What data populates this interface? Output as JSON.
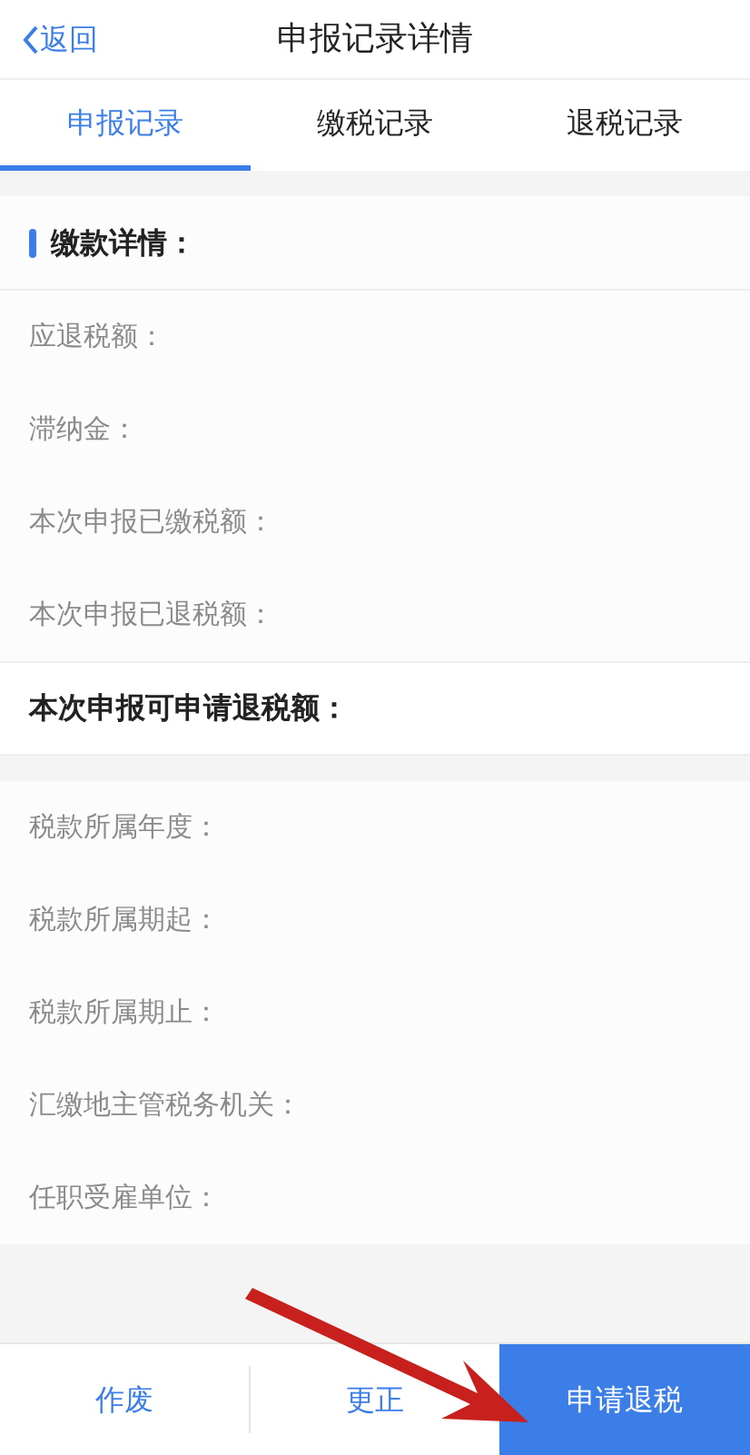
{
  "header": {
    "back": "返回",
    "title": "申报记录详情"
  },
  "tabs": [
    {
      "label": "申报记录",
      "selected": true
    },
    {
      "label": "缴税记录",
      "selected": false
    },
    {
      "label": "退税记录",
      "selected": false
    }
  ],
  "sections": [
    {
      "rows": [
        {
          "kind": "heading",
          "label": "缴款详情："
        },
        {
          "kind": "field",
          "label": "应退税额："
        },
        {
          "kind": "field",
          "label": "滞纳金："
        },
        {
          "kind": "field",
          "label": "本次申报已缴税额："
        },
        {
          "kind": "field",
          "label": "本次申报已退税额："
        },
        {
          "kind": "total",
          "label": "本次申报可申请退税额："
        }
      ]
    },
    {
      "rows": [
        {
          "kind": "field",
          "label": "税款所属年度："
        },
        {
          "kind": "field",
          "label": "税款所属期起："
        },
        {
          "kind": "field",
          "label": "税款所属期止："
        },
        {
          "kind": "field",
          "label": "汇缴地主管税务机关："
        },
        {
          "kind": "field",
          "label": "任职受雇单位："
        }
      ]
    }
  ],
  "footer": {
    "buttons": [
      {
        "label": "作废",
        "kind": "link"
      },
      {
        "label": "更正",
        "kind": "link"
      },
      {
        "label": "申请退税",
        "kind": "primary"
      }
    ]
  }
}
